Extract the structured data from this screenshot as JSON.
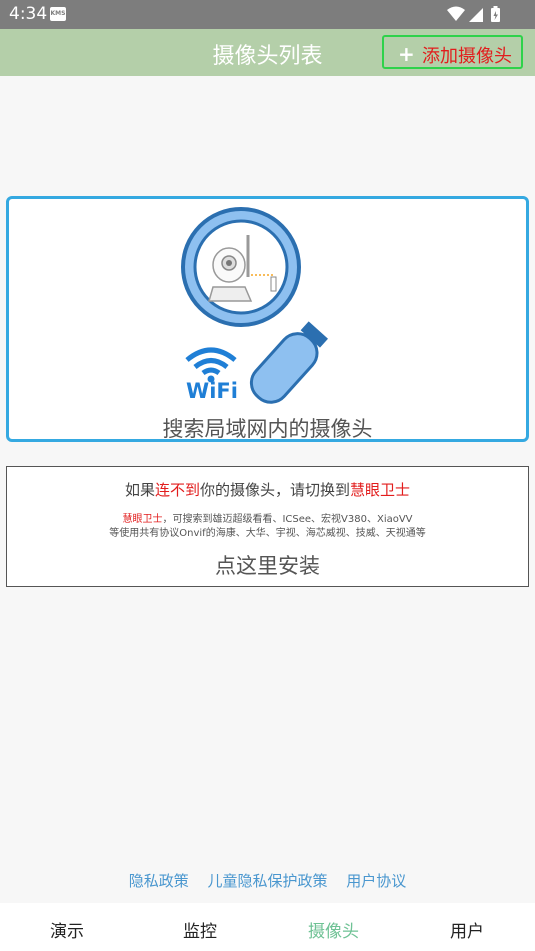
{
  "status_bar": {
    "time": "4:34",
    "notification_badge": "KMS"
  },
  "header": {
    "title": "摄像头列表",
    "add_button": "添加摄像头"
  },
  "search_card": {
    "wifi_label": "WiFi",
    "caption": "搜索局域网内的摄像头"
  },
  "install_card": {
    "line1_prefix": "如果",
    "line1_red1": "连不到",
    "line1_mid": "你的摄像头，请切换到",
    "line1_red2": "慧眼卫士",
    "line2_red": "慧眼卫士",
    "line2_rest": "，可搜索到雄迈超级看看、ICSee、宏视V380、XiaoVV",
    "line3": "等使用共有协议Onvif的海康、大华、宇视、海芯威视、技威、天视通等",
    "action": "点这里安装"
  },
  "links": [
    "隐私政策",
    "儿童隐私保护政策",
    "用户协议"
  ],
  "bottom_nav": {
    "items": [
      "演示",
      "监控",
      "摄像头",
      "用户"
    ],
    "active_index": 2,
    "active_color": "#6fc295"
  },
  "colors": {
    "header_bg": "#b4cfa9",
    "accent_blue": "#35a9e1",
    "red": "#e21d1d",
    "green_border": "#2ed24a"
  }
}
